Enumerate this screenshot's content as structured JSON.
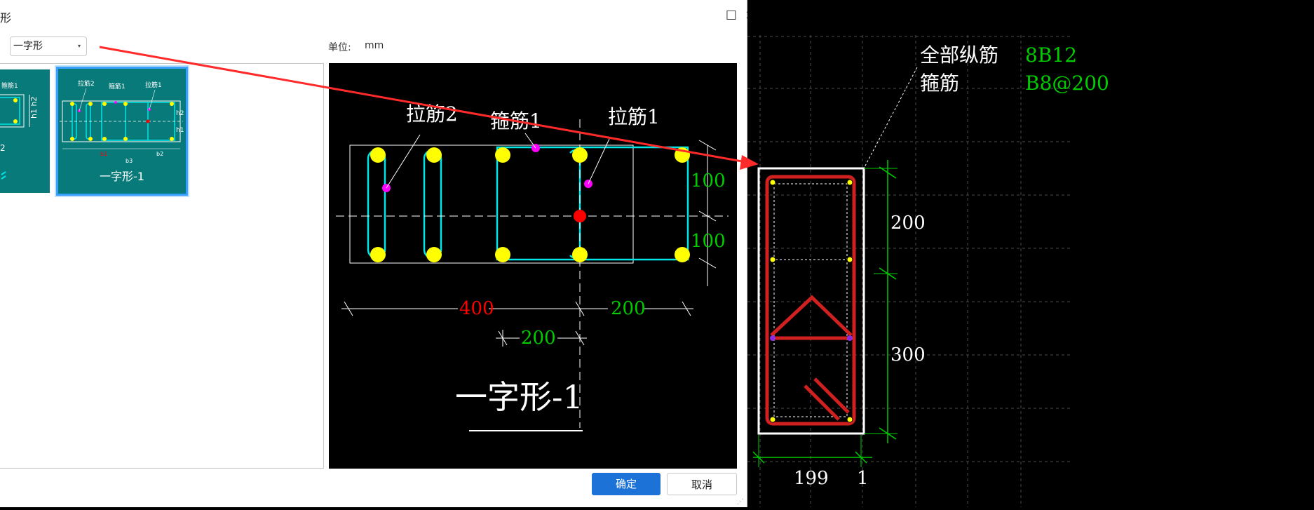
{
  "dialog": {
    "title_fragment": "形",
    "maximize_glyph": "☐",
    "close_glyph": "✕",
    "type_select": {
      "value": "一字形",
      "caret": "▾"
    },
    "unit_label": "单位:",
    "unit_value": "mm",
    "thumbnails": [
      {
        "caption": "",
        "selected": false,
        "labels": {
          "a": "箍筋1",
          "b": "h1 h2",
          "c": "2"
        }
      },
      {
        "caption": "一字形-1",
        "selected": true,
        "labels": {
          "tie2": "拉筋2",
          "stirrup1": "箍筋1",
          "tie1": "拉筋1",
          "h2": "h2",
          "h1": "h1",
          "b1": "b1",
          "b3": "b3",
          "b2": "b2"
        }
      }
    ],
    "preview": {
      "label_tie2": "拉筋2",
      "label_stirrup1": "箍筋1",
      "label_tie1": "拉筋1",
      "dim_right_top": "100",
      "dim_right_bottom": "100",
      "dim_bottom_left": "400",
      "dim_bottom_right": "200",
      "dim_bottom_middle": "200",
      "caption": "一字形-1"
    },
    "ok_label": "确定",
    "cancel_label": "取消",
    "colors": {
      "ok": "#1c72d6",
      "thumb_bg": "#087a7a",
      "rebar": "#00e5e5",
      "bar": "#ffff00",
      "tie_point": "#ff00ff",
      "red_text": "#ff0000",
      "green_text": "#00cc00"
    }
  },
  "cad": {
    "label_long_bars": "全部纵筋",
    "value_long_bars": "8B12",
    "label_stirrup": "箍筋",
    "value_stirrup": "B8@200",
    "dim_upper": "200",
    "dim_lower": "300",
    "dim_width": "199",
    "dim_small": "1"
  }
}
